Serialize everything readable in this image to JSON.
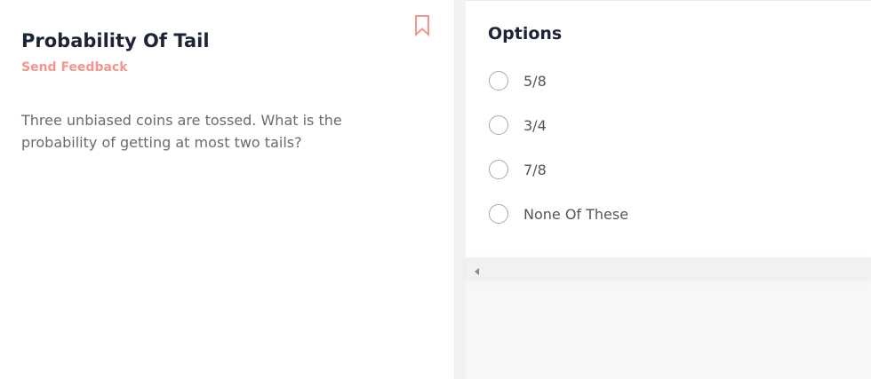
{
  "question": {
    "title": "Probability Of Tail",
    "feedback_label": "Send Feedback",
    "text": "Three unbiased coins are tossed. What is the probability of getting at most two tails?"
  },
  "options": {
    "title": "Options",
    "items": [
      {
        "label": "5/8"
      },
      {
        "label": "3/4"
      },
      {
        "label": "7/8"
      },
      {
        "label": "None Of These"
      }
    ]
  },
  "colors": {
    "accent": "#f2968f",
    "title": "#1e2437",
    "body_text": "#6b6b6b"
  },
  "icons": {
    "bookmark": "bookmark-icon",
    "scroll": "triangle-left-icon"
  }
}
